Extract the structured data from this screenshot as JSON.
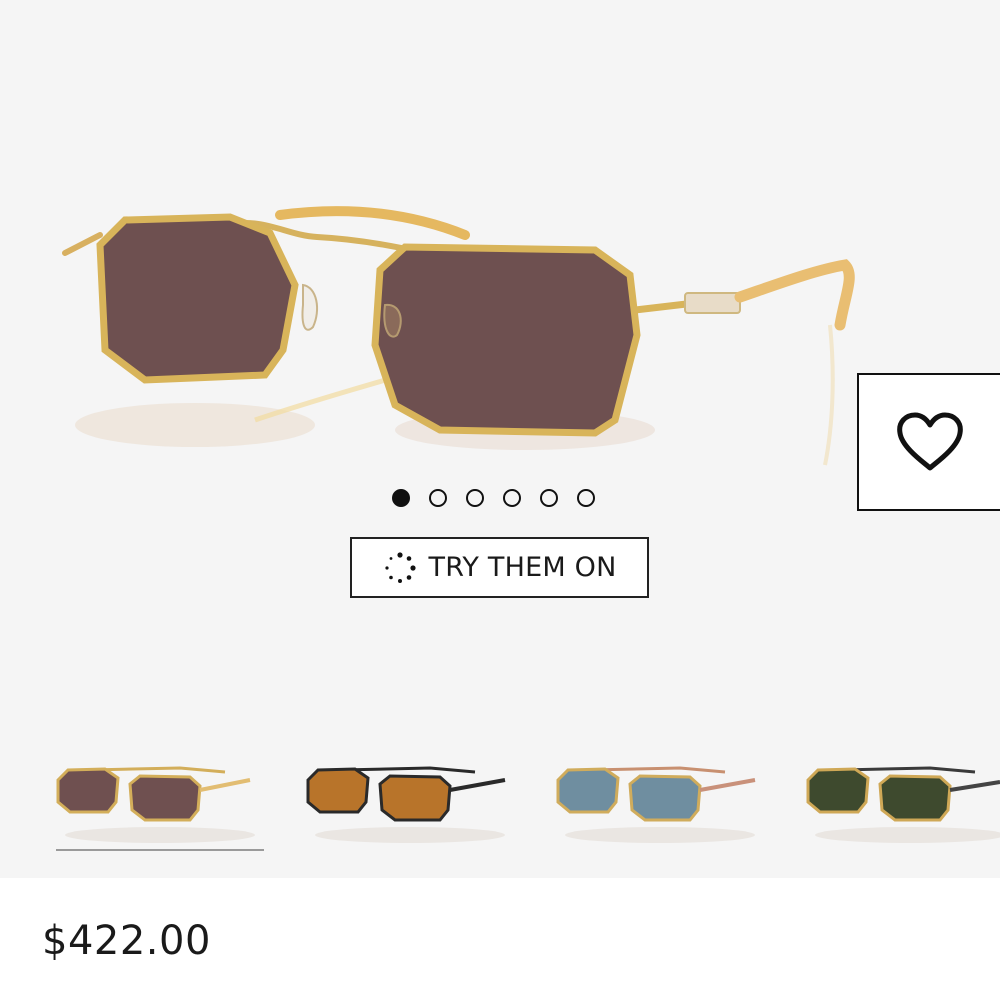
{
  "product": {
    "price": "$422.00",
    "main_lens_color": "#6e5050",
    "frame_color": "#d8b45a"
  },
  "gallery": {
    "dots_total": 6,
    "active_dot_index": 0
  },
  "try_on": {
    "label": "TRY THEM ON",
    "icon": "face-scan-icon"
  },
  "wishlist": {
    "icon": "heart-icon"
  },
  "variants": [
    {
      "name": "gold-brown-lens",
      "lens": "#6f5050",
      "frame": "#d3ae5a",
      "selected": true
    },
    {
      "name": "black-orange-lens",
      "lens": "#b8742a",
      "frame": "#2a2a2a",
      "selected": false
    },
    {
      "name": "gold-blue-lens",
      "lens": "#6f8ea0",
      "frame": "#d0ac5c",
      "selected": false
    },
    {
      "name": "gold-green-lens",
      "lens": "#3e4a2e",
      "frame": "#cfa856",
      "selected": false
    }
  ]
}
